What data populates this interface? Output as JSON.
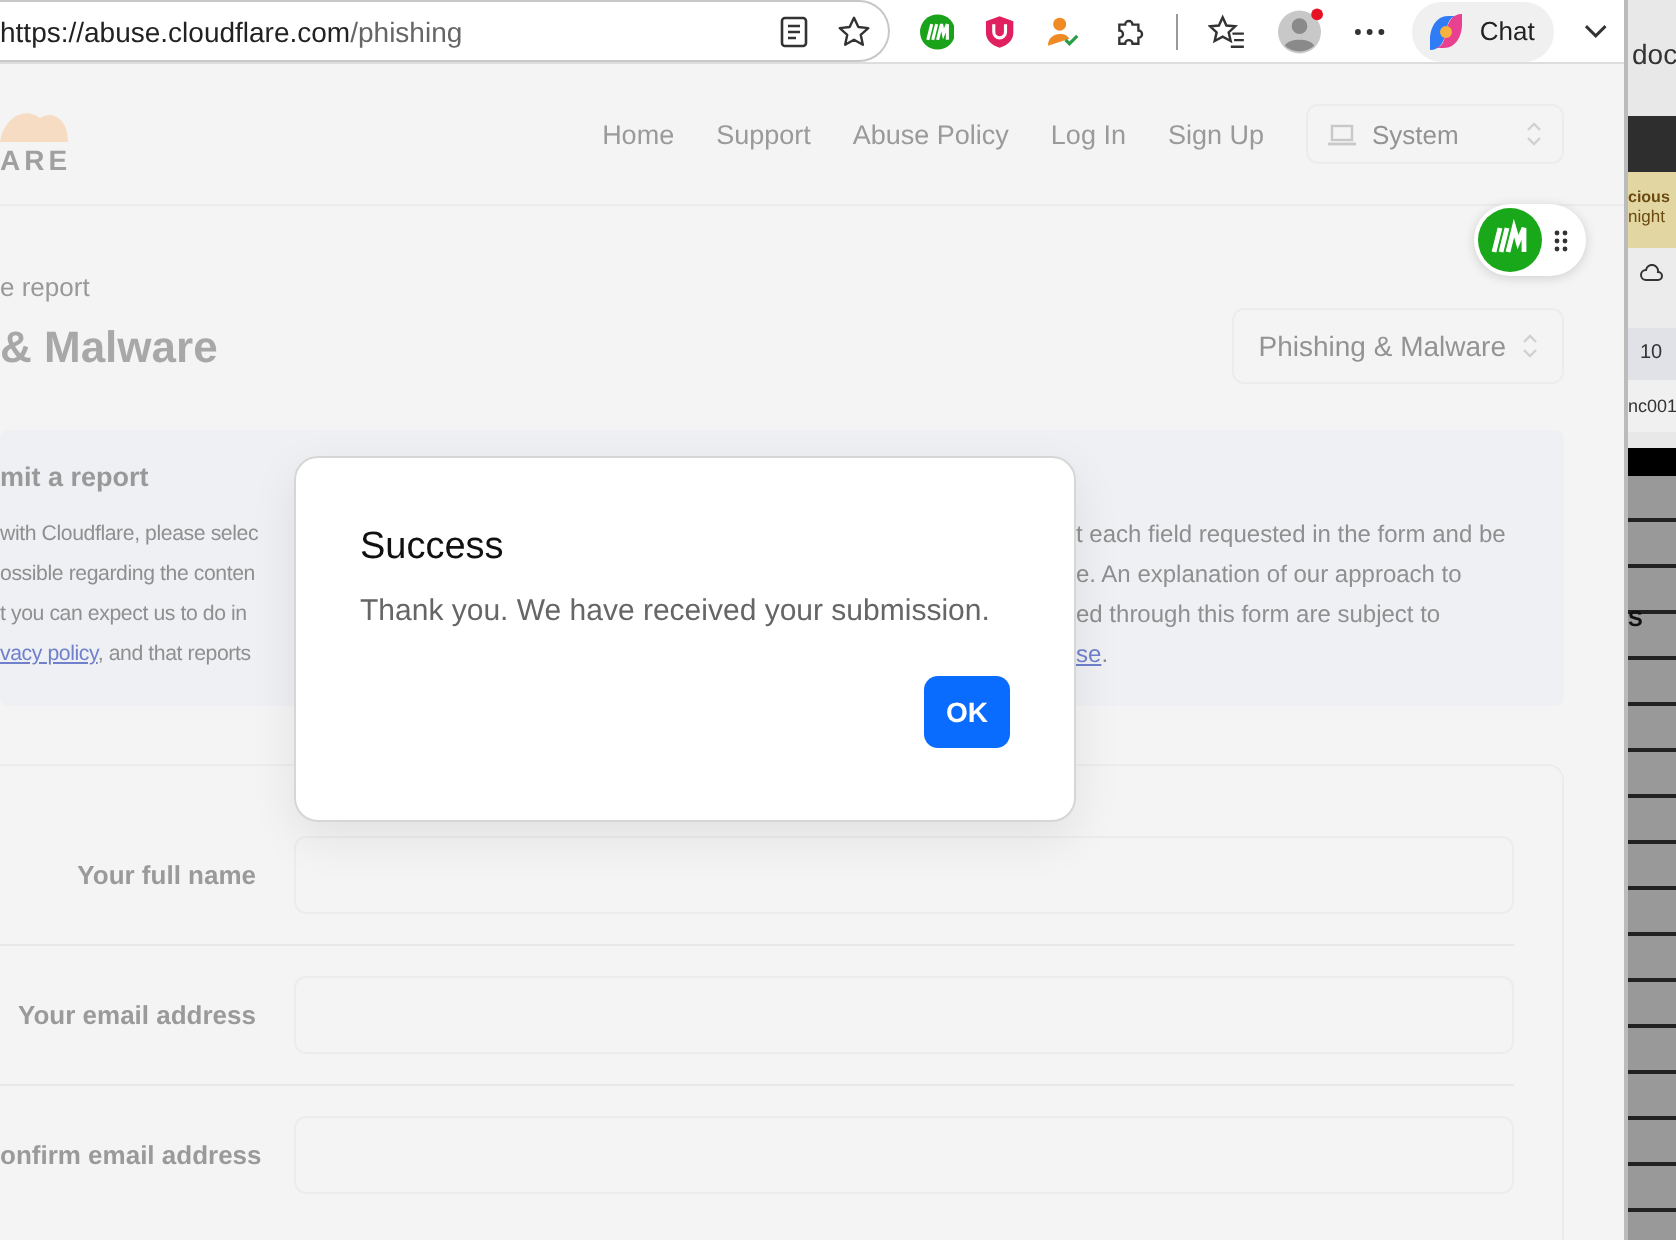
{
  "browser": {
    "url_host": "https://abuse.cloudflare.com",
    "url_path": "/phishing",
    "chat_label": "Chat"
  },
  "header": {
    "logo_text": "ARE",
    "nav": [
      "Home",
      "Support",
      "Abuse Policy",
      "Log In",
      "Sign Up"
    ],
    "theme_select": "System"
  },
  "breadcrumb": "e report",
  "title": "& Malware",
  "report_type_select": "Phishing & Malware",
  "notice": {
    "heading": "mit a report",
    "lines": [
      {
        "left": "with Cloudflare, please selec",
        "right": "t each field requested in the form and be"
      },
      {
        "left": "ossible regarding the conten",
        "right": "e. An explanation of our approach to"
      },
      {
        "left": "t you can expect us to do in",
        "right": "ed through this form are subject to"
      },
      {
        "left_link": "vacy policy",
        "left": ", and that reports",
        "right_link": "se",
        "right": "."
      }
    ]
  },
  "form": {
    "fields": [
      {
        "label": "Your full name"
      },
      {
        "label": "Your email address"
      },
      {
        "label": "onfirm email address"
      }
    ]
  },
  "dialog": {
    "title": "Success",
    "message": "Thank you. We have received your submission.",
    "button": "OK"
  },
  "background_window": {
    "texts": [
      "doc",
      "cious",
      "night",
      "10",
      "nc001",
      "S"
    ]
  }
}
